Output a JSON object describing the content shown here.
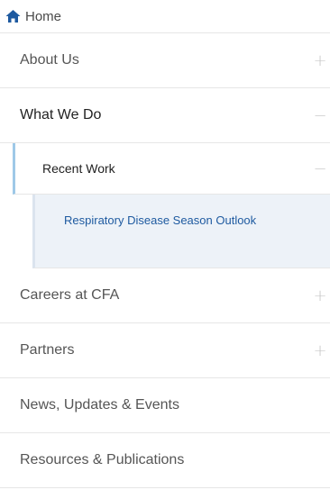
{
  "home": {
    "label": "Home",
    "icon": "home-icon",
    "icon_color": "#1e5aa0"
  },
  "menu": {
    "items": [
      {
        "label": "About Us",
        "toggle": "+"
      },
      {
        "label": "What We Do",
        "toggle": "−"
      },
      {
        "label": "Careers at CFA",
        "toggle": "+"
      },
      {
        "label": "Partners",
        "toggle": "+"
      },
      {
        "label": "News, Updates & Events"
      },
      {
        "label": "Resources & Publications"
      }
    ],
    "submenu": {
      "label": "Recent Work",
      "toggle": "−",
      "leaf_label": "Respiratory Disease Season Outlook"
    }
  },
  "colors": {
    "accent": "#1e5aa0",
    "active_bar": "#9ec9e8",
    "leaf_bg": "#edf2f8"
  }
}
